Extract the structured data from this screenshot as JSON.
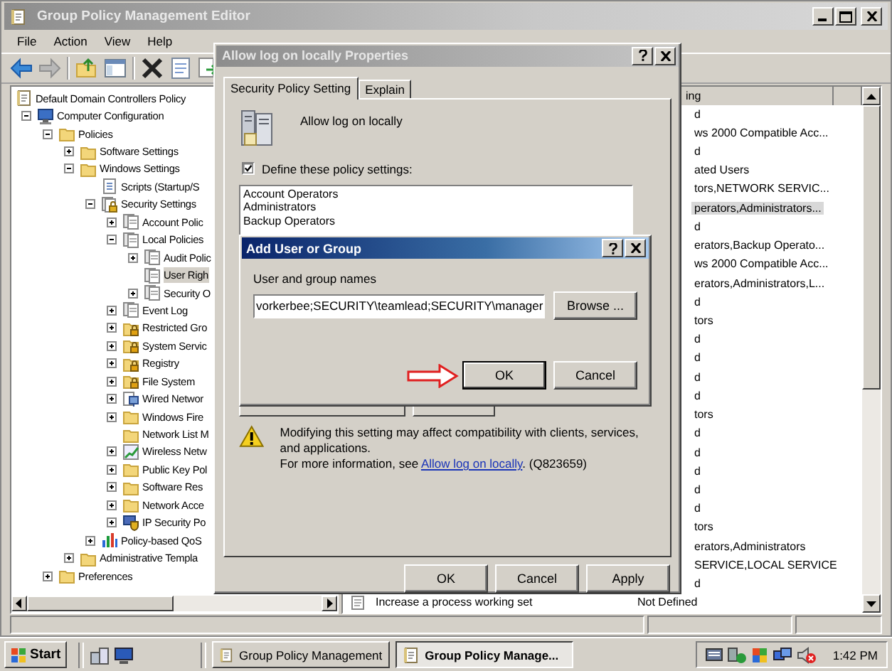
{
  "window": {
    "title": "Group Policy Management Editor"
  },
  "menu": [
    "File",
    "Action",
    "View",
    "Help"
  ],
  "tree": [
    {
      "label": "Default Domain Controllers Policy",
      "kind": "document",
      "expandable": false,
      "selected": false,
      "children": [
        {
          "label": "Computer Configuration",
          "kind": "computer",
          "expandable": true,
          "expanded": true,
          "selected": false,
          "children": [
            {
              "label": "Policies",
              "kind": "folder",
              "expandable": true,
              "expanded": true,
              "selected": false,
              "children": [
                {
                  "label": "Software Settings",
                  "kind": "folder",
                  "expandable": true,
                  "expanded": false,
                  "selected": false
                },
                {
                  "label": "Windows Settings",
                  "kind": "folder",
                  "expandable": true,
                  "expanded": true,
                  "selected": false,
                  "children": [
                    {
                      "label": "Scripts (Startup/S",
                      "kind": "script",
                      "expandable": false,
                      "selected": false
                    },
                    {
                      "label": "Security Settings",
                      "kind": "secured",
                      "expandable": true,
                      "expanded": true,
                      "selected": false,
                      "children": [
                        {
                          "label": "Account Polic",
                          "kind": "policy",
                          "expandable": true,
                          "expanded": false,
                          "selected": false
                        },
                        {
                          "label": "Local Policies",
                          "kind": "policy",
                          "expandable": true,
                          "expanded": true,
                          "selected": false,
                          "children": [
                            {
                              "label": "Audit Polic",
                              "kind": "policy",
                              "expandable": true,
                              "expanded": false,
                              "selected": false
                            },
                            {
                              "label": "User Righ",
                              "kind": "policy",
                              "expandable": false,
                              "selected": true
                            },
                            {
                              "label": "Security O",
                              "kind": "policy",
                              "expandable": true,
                              "expanded": false,
                              "selected": false
                            }
                          ]
                        },
                        {
                          "label": "Event Log",
                          "kind": "policy",
                          "expandable": true,
                          "expanded": false,
                          "selected": false
                        },
                        {
                          "label": "Restricted Gro",
                          "kind": "lockfolder",
                          "expandable": true,
                          "expanded": false,
                          "selected": false
                        },
                        {
                          "label": "System Servic",
                          "kind": "lockfolder",
                          "expandable": true,
                          "expanded": false,
                          "selected": false
                        },
                        {
                          "label": "Registry",
                          "kind": "lockfolder",
                          "expandable": true,
                          "expanded": false,
                          "selected": false
                        },
                        {
                          "label": "File System",
                          "kind": "lockfolder",
                          "expandable": true,
                          "expanded": false,
                          "selected": false
                        },
                        {
                          "label": "Wired Networ",
                          "kind": "network",
                          "expandable": true,
                          "expanded": false,
                          "selected": false
                        },
                        {
                          "label": "Windows Fire",
                          "kind": "folder",
                          "expandable": true,
                          "expanded": false,
                          "selected": false
                        },
                        {
                          "label": "Network List M",
                          "kind": "folder",
                          "expandable": false,
                          "selected": false
                        },
                        {
                          "label": "Wireless Netw",
                          "kind": "wireless",
                          "expandable": true,
                          "expanded": false,
                          "selected": false
                        },
                        {
                          "label": "Public Key Pol",
                          "kind": "folder",
                          "expandable": true,
                          "expanded": false,
                          "selected": false
                        },
                        {
                          "label": "Software Res",
                          "kind": "folder",
                          "expandable": true,
                          "expanded": false,
                          "selected": false
                        },
                        {
                          "label": "Network Acce",
                          "kind": "folder",
                          "expandable": true,
                          "expanded": false,
                          "selected": false
                        },
                        {
                          "label": "IP Security Po",
                          "kind": "shield",
                          "expandable": true,
                          "expanded": false,
                          "selected": false
                        }
                      ]
                    },
                    {
                      "label": "Policy-based QoS",
                      "kind": "chart",
                      "expandable": true,
                      "expanded": false,
                      "selected": false
                    }
                  ]
                },
                {
                  "label": "Administrative Templa",
                  "kind": "folder",
                  "expandable": true,
                  "expanded": false,
                  "selected": false
                }
              ]
            },
            {
              "label": "Preferences",
              "kind": "folder",
              "expandable": true,
              "expanded": false,
              "selected": false
            }
          ]
        }
      ]
    }
  ],
  "list": {
    "columns": [
      "ing"
    ],
    "rows": [
      {
        "setting": "d",
        "selected": false
      },
      {
        "setting": "ws 2000 Compatible Acc...",
        "selected": false
      },
      {
        "setting": "d",
        "selected": false
      },
      {
        "setting": "ated Users",
        "selected": false
      },
      {
        "setting": "tors,NETWORK SERVIC...",
        "selected": false
      },
      {
        "setting": "perators,Administrators...",
        "selected": true
      },
      {
        "setting": "d",
        "selected": false
      },
      {
        "setting": "erators,Backup Operato...",
        "selected": false
      },
      {
        "setting": "ws 2000 Compatible Acc...",
        "selected": false
      },
      {
        "setting": "erators,Administrators,L...",
        "selected": false
      },
      {
        "setting": "d",
        "selected": false
      },
      {
        "setting": "tors",
        "selected": false
      },
      {
        "setting": "d",
        "selected": false
      },
      {
        "setting": "d",
        "selected": false
      },
      {
        "setting": "d",
        "selected": false
      },
      {
        "setting": "d",
        "selected": false
      },
      {
        "setting": "tors",
        "selected": false
      },
      {
        "setting": "d",
        "selected": false
      },
      {
        "setting": "d",
        "selected": false
      },
      {
        "setting": "d",
        "selected": false
      },
      {
        "setting": "d",
        "selected": false
      },
      {
        "setting": "d",
        "selected": false
      },
      {
        "setting": "tors",
        "selected": false
      },
      {
        "setting": "erators,Administrators",
        "selected": false
      },
      {
        "setting": "SERVICE,LOCAL SERVICE",
        "selected": false
      },
      {
        "setting": "d",
        "selected": false
      },
      {
        "policy": "Increase a process working set",
        "setting": "Not Defined",
        "selected": false
      }
    ]
  },
  "properties_dialog": {
    "title": "Allow log on locally Properties",
    "tabs": [
      {
        "label": "Security Policy Setting",
        "selected": true
      },
      {
        "label": "Explain",
        "selected": false
      }
    ],
    "policy_name": "Allow log on locally",
    "define_checkbox": {
      "label": "Define these policy settings:",
      "checked": true
    },
    "members": [
      "Account Operators",
      "Administrators",
      "Backup Operators"
    ],
    "warning": {
      "text": "Modifying this setting may affect compatibility with clients, services, and applications.",
      "more_prefix": "For more information, see ",
      "link": "Allow log on locally",
      "more_suffix": ". (Q823659)"
    },
    "buttons": [
      "OK",
      "Cancel",
      "Apply"
    ]
  },
  "add_dialog": {
    "title": "Add User or Group",
    "field_label": "User and group names",
    "value": "vorkerbee;SECURITY\\teamlead;SECURITY\\manager",
    "browse": "Browse ...",
    "buttons": [
      "OK",
      "Cancel"
    ]
  },
  "taskbar": {
    "start": "Start",
    "tasks": [
      {
        "label": "Group Policy Management",
        "selected": false
      },
      {
        "label": "Group Policy Manage...",
        "selected": true
      }
    ],
    "clock": "1:42 PM"
  }
}
